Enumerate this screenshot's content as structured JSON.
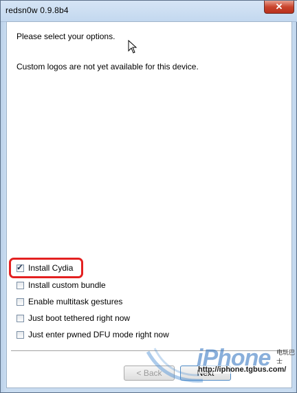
{
  "window": {
    "title": "redsn0w 0.9.8b4",
    "close_glyph": "✕"
  },
  "content": {
    "message_select": "Please select your options.",
    "message_logos": "Custom logos are not yet available for this device."
  },
  "options": [
    {
      "label": "Install Cydia",
      "checked": true
    },
    {
      "label": "Install custom bundle",
      "checked": false
    },
    {
      "label": "Enable multitask gestures",
      "checked": false
    },
    {
      "label": "Just boot tethered right now",
      "checked": false
    },
    {
      "label": "Just enter pwned DFU mode right now",
      "checked": false
    }
  ],
  "buttons": {
    "back": "< Back",
    "next": "Next"
  },
  "watermark": {
    "brand": "iPhone",
    "url": "http://iphone.tgbus.com/",
    "corner": "电玩巴士"
  },
  "colors": {
    "highlight": "#e32020",
    "titlebar": "#c3d8ef"
  },
  "icons": {
    "cursor": "mouse-pointer-icon",
    "check": "checkmark-icon"
  }
}
